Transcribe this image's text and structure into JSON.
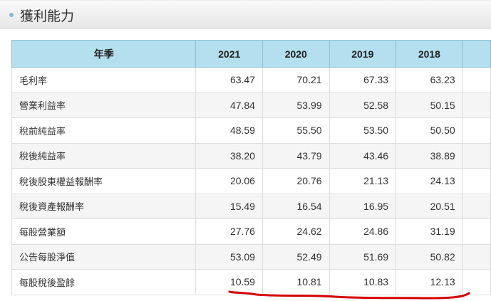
{
  "section_title": "獲利能力",
  "table": {
    "headers": [
      "年季",
      "2021",
      "2020",
      "2019",
      "2018",
      ""
    ],
    "rows": [
      {
        "label": "毛利率",
        "values": [
          "63.47",
          "70.21",
          "67.33",
          "63.23"
        ]
      },
      {
        "label": "營業利益率",
        "values": [
          "47.84",
          "53.99",
          "52.58",
          "50.15"
        ]
      },
      {
        "label": "稅前純益率",
        "values": [
          "48.59",
          "55.50",
          "53.50",
          "50.50"
        ]
      },
      {
        "label": "稅後純益率",
        "values": [
          "38.20",
          "43.79",
          "43.46",
          "38.89"
        ]
      },
      {
        "label": "稅後股東權益報酬率",
        "values": [
          "20.06",
          "20.76",
          "21.13",
          "24.13"
        ]
      },
      {
        "label": "稅後資產報酬率",
        "values": [
          "15.49",
          "16.54",
          "16.95",
          "20.51"
        ]
      },
      {
        "label": "每股營業額",
        "values": [
          "27.76",
          "24.62",
          "24.86",
          "31.19"
        ]
      },
      {
        "label": "公告每股淨值",
        "values": [
          "53.09",
          "52.49",
          "51.69",
          "50.82"
        ]
      },
      {
        "label": "每股稅後盈餘",
        "values": [
          "10.59",
          "10.81",
          "10.83",
          "12.13"
        ]
      }
    ]
  },
  "annotation_color": "#d40000"
}
